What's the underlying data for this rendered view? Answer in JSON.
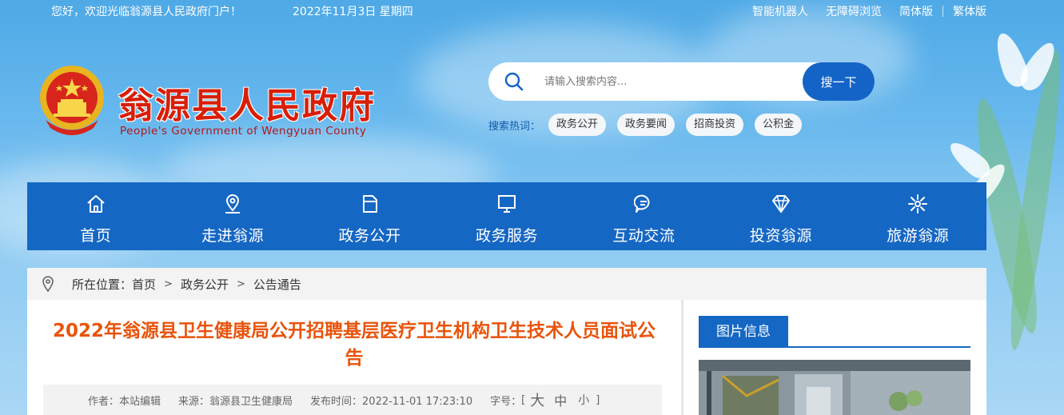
{
  "topbar": {
    "welcome": "您好，欢迎光临翁源县人民政府门户！",
    "date": "2022年11月3日  星期四",
    "links": [
      "智能机器人",
      "无障碍浏览",
      "简体版",
      "繁体版"
    ]
  },
  "header": {
    "title": "翁源县人民政府",
    "subtitle": "People's Government of Wengyuan County"
  },
  "search": {
    "placeholder": "请输入搜索内容...",
    "button": "搜一下",
    "hot_label": "搜索热词：",
    "hot_tags": [
      "政务公开",
      "政务要闻",
      "招商投资",
      "公积金"
    ]
  },
  "nav": {
    "items": [
      {
        "label": "首页",
        "icon": "home-icon"
      },
      {
        "label": "走进翁源",
        "icon": "location-icon"
      },
      {
        "label": "政务公开",
        "icon": "folder-icon"
      },
      {
        "label": "政务服务",
        "icon": "monitor-icon"
      },
      {
        "label": "互动交流",
        "icon": "chat-icon"
      },
      {
        "label": "投资翁源",
        "icon": "diamond-icon"
      },
      {
        "label": "旅游翁源",
        "icon": "flower-icon"
      }
    ]
  },
  "breadcrumb": {
    "label": "所在位置：",
    "items": [
      "首页",
      "政务公开",
      "公告通告"
    ],
    "separator": ">"
  },
  "article": {
    "title": "2022年翁源县卫生健康局公开招聘基层医疗卫生机构卫生技术人员面试公告",
    "author": "作者：本站编辑",
    "source": "来源：翁源县卫生健康局",
    "published": "发布时间：2022-11-01 17:23:10",
    "fontsize_label": "字号：",
    "fontsize_open": "[",
    "fontsize_options": [
      "大",
      "中",
      "小"
    ],
    "fontsize_close": "]"
  },
  "side": {
    "tab": "图片信息"
  },
  "colors": {
    "nav_bg": "#1567c4",
    "title_red": "#d81e06",
    "article_title": "#e8540c",
    "search_button": "#1464c8"
  }
}
